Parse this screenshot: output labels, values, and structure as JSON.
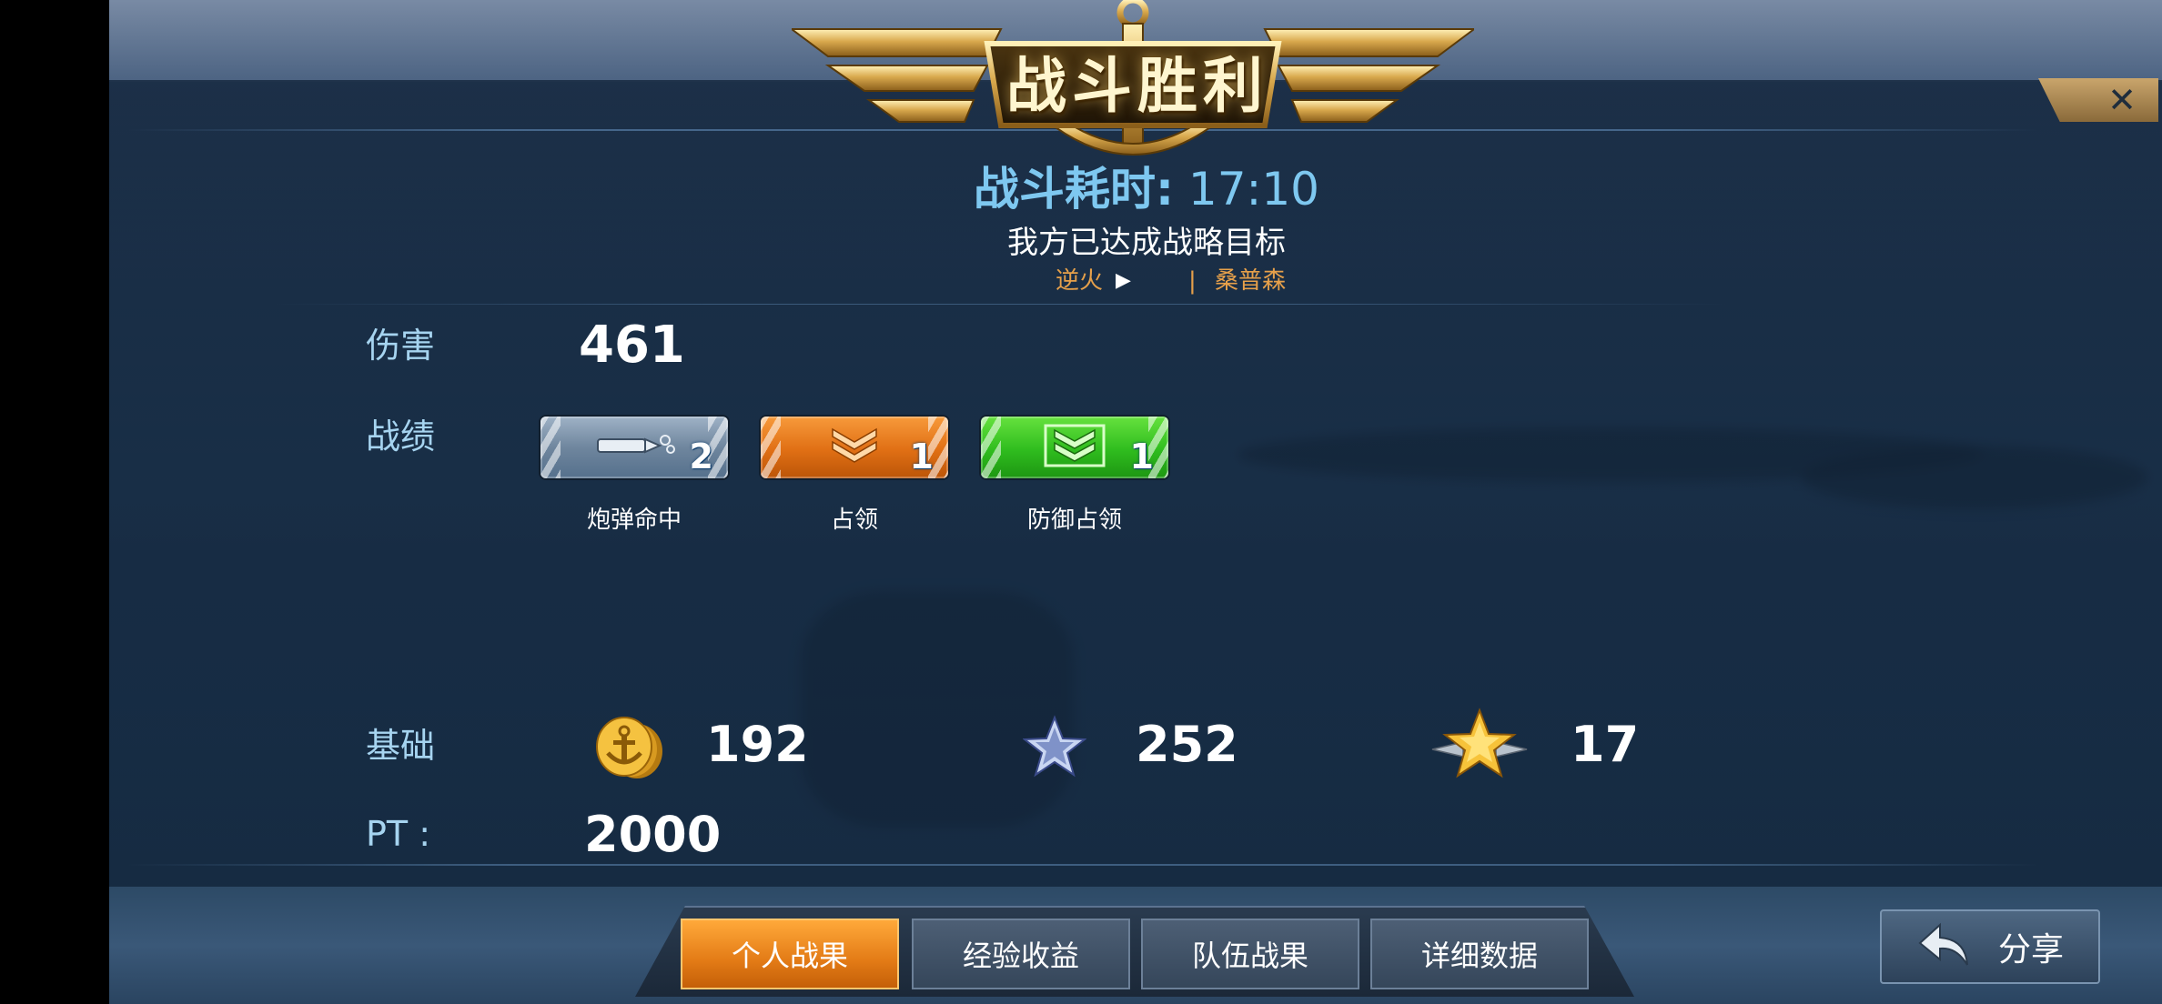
{
  "header": {
    "title": "战斗胜利",
    "close_symbol": "✕",
    "duration_label": "战斗耗时:",
    "duration_value": "17:10",
    "objective": "我方已达成战略目标",
    "kill_feed": {
      "killer": "逆火",
      "arrow": "▶",
      "separator": "|",
      "victim": "桑普森"
    }
  },
  "stats": {
    "damage": {
      "label": "伤害",
      "value": "461"
    },
    "achievements": {
      "label": "战绩",
      "items": [
        {
          "name": "炮弹命中",
          "count": "2",
          "color": "#6f869e",
          "icon": "shell-icon"
        },
        {
          "name": "占领",
          "count": "1",
          "color": "#e06f14",
          "icon": "chevron-icon"
        },
        {
          "name": "防御占领",
          "count": "1",
          "color": "#2fbc1e",
          "icon": "shield-chevron-icon"
        }
      ]
    },
    "base": {
      "label": "基础",
      "gold": {
        "icon": "anchor-coin-icon",
        "value": "192"
      },
      "exp": {
        "icon": "silver-star-icon",
        "value": "252"
      },
      "rank": {
        "icon": "gold-winged-star-icon",
        "value": "17"
      }
    },
    "pt": {
      "label": "PT :",
      "value": "2000"
    }
  },
  "tabs": [
    {
      "label": "个人战果",
      "active": true
    },
    {
      "label": "经验收益",
      "active": false
    },
    {
      "label": "队伍战果",
      "active": false
    },
    {
      "label": "详细数据",
      "active": false
    }
  ],
  "share": {
    "label": "分享",
    "icon": "return-arrow-icon"
  },
  "colors": {
    "accent_blue": "#7ec8f0",
    "label_blue": "#a6d4f0",
    "gold": "#e6a04a",
    "active_tab": "#e37b16"
  }
}
